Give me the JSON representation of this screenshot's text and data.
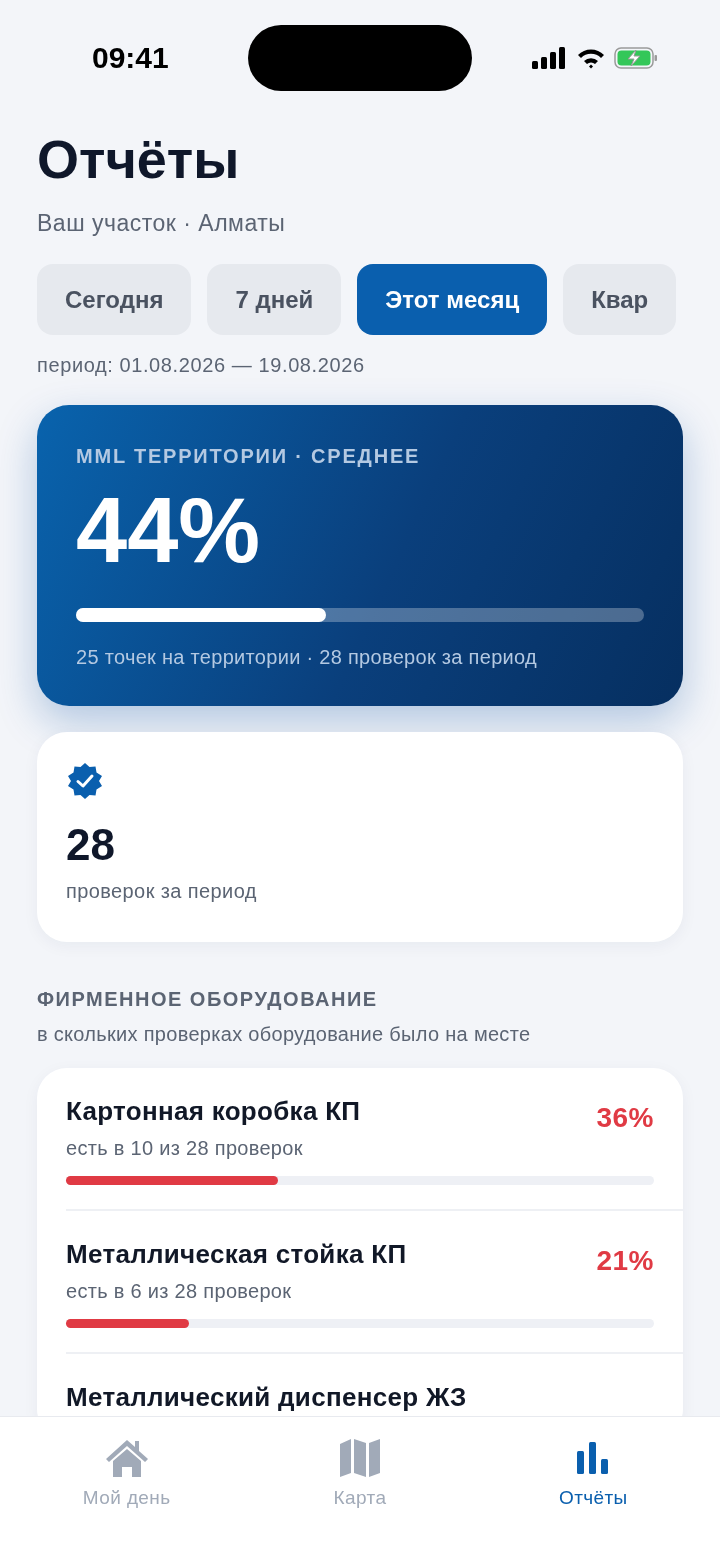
{
  "status_bar": {
    "time": "09:41"
  },
  "header": {
    "title": "Отчёты",
    "subtitle": "Ваш участок · Алматы"
  },
  "periods": [
    {
      "label": "Сегодня",
      "selected": false
    },
    {
      "label": "7 дней",
      "selected": false
    },
    {
      "label": "Этот месяц",
      "selected": true
    },
    {
      "label": "Квар",
      "selected": false
    }
  ],
  "period_range": "период: 01.08.2026 — 19.08.2026",
  "summary": {
    "label": "MML ТЕРРИТОРИИ · СРЕДНЕЕ",
    "value": "44%",
    "level": 0.44,
    "caption": "25 точек на территории · 28 проверок за период"
  },
  "checks_card": {
    "value": "28",
    "caption": "проверок за период"
  },
  "equipment": {
    "title": "ФИРМЕННОЕ ОБОРУДОВАНИЕ",
    "subtitle": "в скольких проверках оборудование было на месте",
    "items": [
      {
        "name": "Картонная коробка КП",
        "detail": "есть в 10 из 28 проверок",
        "percent": "36%",
        "level": 0.36
      },
      {
        "name": "Металлическая стойка КП",
        "detail": "есть в 6 из 28 проверок",
        "percent": "21%",
        "level": 0.21
      },
      {
        "name": "Металлический диспенсер ЖЗ"
      }
    ]
  },
  "tab_bar": [
    {
      "label": "Мой день",
      "kind": "home",
      "selected": false
    },
    {
      "label": "Карта",
      "kind": "map",
      "selected": false
    },
    {
      "label": "Отчёты",
      "kind": "chart",
      "selected": true
    }
  ]
}
